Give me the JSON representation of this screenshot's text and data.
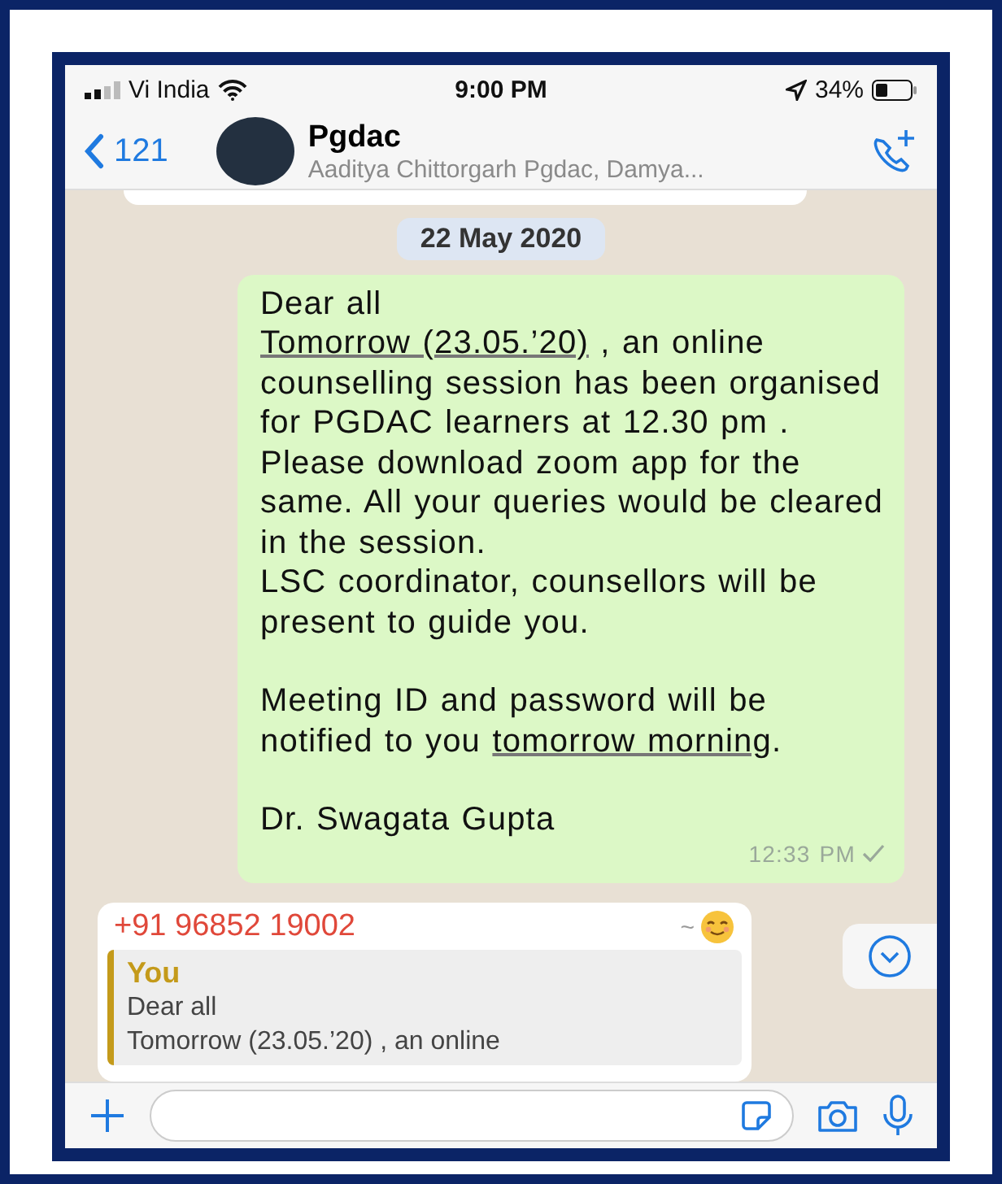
{
  "status_bar": {
    "carrier": "Vi India",
    "time": "9:00 PM",
    "battery": "34%"
  },
  "header": {
    "back_count": "121",
    "title": "Pgdac",
    "subtitle": "Aaditya Chittorgarh Pgdac, Damya..."
  },
  "chat": {
    "date": "22 May 2020",
    "message": {
      "blocks": [
        {
          "gap_before": false,
          "segments": [
            {
              "kind": "plain",
              "text": "Dear all"
            }
          ]
        },
        {
          "gap_before": false,
          "segments": [
            {
              "kind": "link",
              "text": "Tomorrow (23.05.’20)"
            },
            {
              "kind": "plain",
              "text": " , an online counselling session has been organised for PGDAC learners at 12.30 pm . Please download zoom app for the same. All your queries would be cleared in the session."
            }
          ]
        },
        {
          "gap_before": false,
          "segments": [
            {
              "kind": "plain",
              "text": "LSC coordinator, counsellors will be present to guide you."
            }
          ]
        },
        {
          "gap_before": true,
          "segments": [
            {
              "kind": "plain",
              "text": "Meeting ID and password will be notified to you "
            },
            {
              "kind": "link",
              "text": "tomorrow morning"
            },
            {
              "kind": "plain",
              "text": "."
            }
          ]
        },
        {
          "gap_before": true,
          "segments": [
            {
              "kind": "plain",
              "text": "Dr. Swagata Gupta"
            }
          ]
        }
      ],
      "time": "12:33 PM"
    },
    "reply": {
      "sender": "+91 96852 19002",
      "sender_tag": "~",
      "quote_author": "You",
      "quote_lines": [
        "Dear all",
        "Tomorrow (23.05.’20) , an online"
      ]
    }
  }
}
